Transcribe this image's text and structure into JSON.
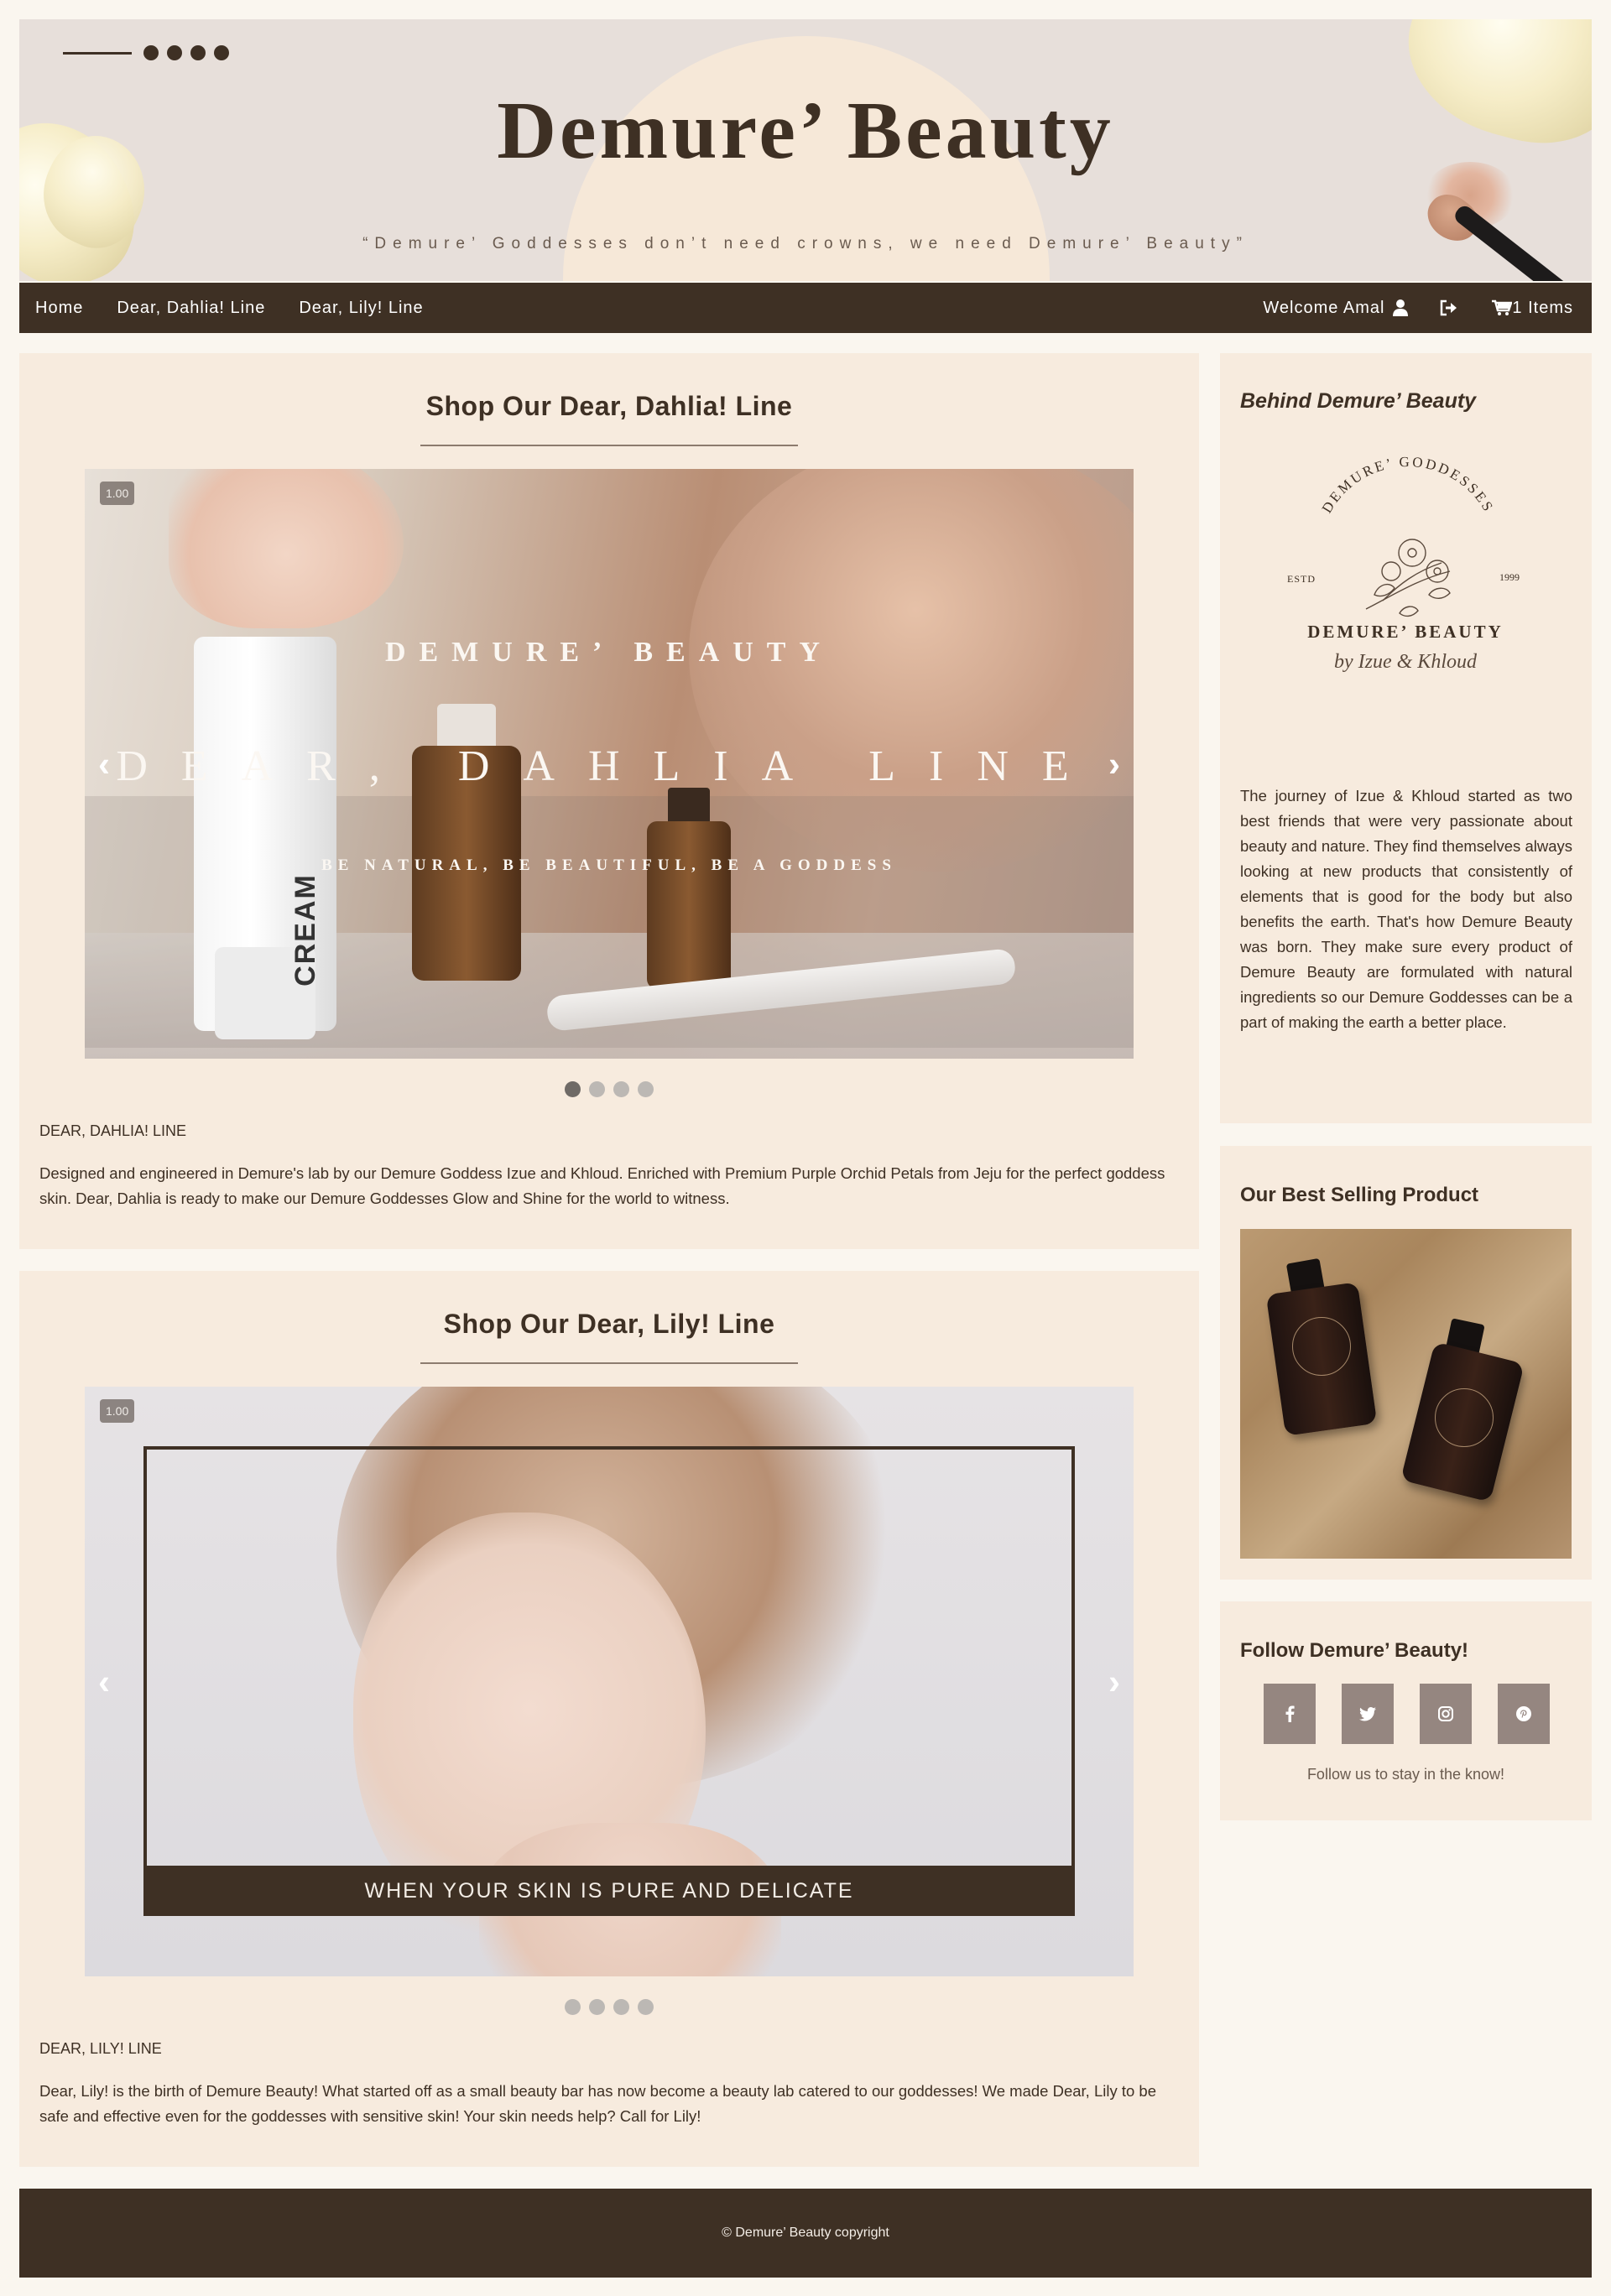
{
  "header": {
    "title": "Demure’ Beauty",
    "tagline": "“Demure’ Goddesses don’t need crowns, we need Demure’ Beauty”"
  },
  "nav": {
    "items": [
      "Home",
      "Dear, Dahlia! Line",
      "Dear, Lily! Line"
    ],
    "welcome": "Welcome Amal",
    "cart": "1 Items",
    "icons": {
      "user": "user-icon",
      "logout": "logout-icon",
      "cart": "cart-icon"
    }
  },
  "dahlia": {
    "heading": "Shop Our Dear, Dahlia! Line",
    "counter": "1.00",
    "slide": {
      "brand": "DEMURE’ BEAUTY",
      "line": "DEAR, DAHLIA LINE",
      "motto": "BE NATURAL, BE BEAUTIFUL, BE A GODDESS",
      "tube_label": "CREAM"
    },
    "prev": "‹",
    "next": "›",
    "slides_count": 4,
    "active_slide": 1,
    "label": "DEAR, DAHLIA! LINE",
    "description": "Designed and engineered in Demure's lab by our Demure Goddess Izue and Khloud. Enriched with Premium Purple Orchid Petals from Jeju for the perfect goddess skin. Dear, Dahlia is ready to make our Demure Goddesses Glow and Shine for the world to witness."
  },
  "lily": {
    "heading": "Shop Our Dear, Lily! Line",
    "counter": "1.00",
    "caption": "WHEN YOUR SKIN IS PURE AND DELICATE",
    "prev": "‹",
    "next": "›",
    "slides_count": 4,
    "active_slide": 0,
    "label": "DEAR, LILY! LINE",
    "description": "Dear, Lily! is the birth of Demure Beauty! What started off as a small beauty bar has now become a beauty lab catered to our goddesses! We made Dear, Lily to be safe and effective even for the goddesses with sensitive skin! Your skin needs help? Call for Lily!"
  },
  "sidebar": {
    "about_title": "Behind Demure’ Beauty",
    "logo": {
      "arc_text": "DEMURE’ GODDESSES",
      "estd": "ESTD",
      "year": "1999",
      "name": "DEMURE’ BEAUTY",
      "signature": "by Izue & Khloud"
    },
    "about_text": "The journey of Izue & Khloud started as two best friends that were very passionate about beauty and nature. They find themselves always looking at new products that consistently of elements that is good for the body but also benefits the earth. That's how Demure Beauty was born. They make sure every product of Demure Beauty are formulated with natural ingredients so our Demure Goddesses can be a part of making the earth a better place.",
    "best_title": "Our Best Selling Product",
    "follow_title": "Follow Demure’ Beauty!",
    "social": [
      {
        "icon": "facebook-icon",
        "glyph": "f"
      },
      {
        "icon": "twitter-icon",
        "glyph": "t"
      },
      {
        "icon": "instagram-icon",
        "glyph": "ig"
      },
      {
        "icon": "pinterest-icon",
        "glyph": "p"
      }
    ],
    "follow_note": "Follow us to stay in the know!"
  },
  "footer": {
    "copyright": "© Demure’ Beauty copyright"
  },
  "colors": {
    "brand_dark": "#3e3024",
    "panel": "#f7ebde",
    "page": "#faf6ef",
    "social_bg": "#958680"
  }
}
